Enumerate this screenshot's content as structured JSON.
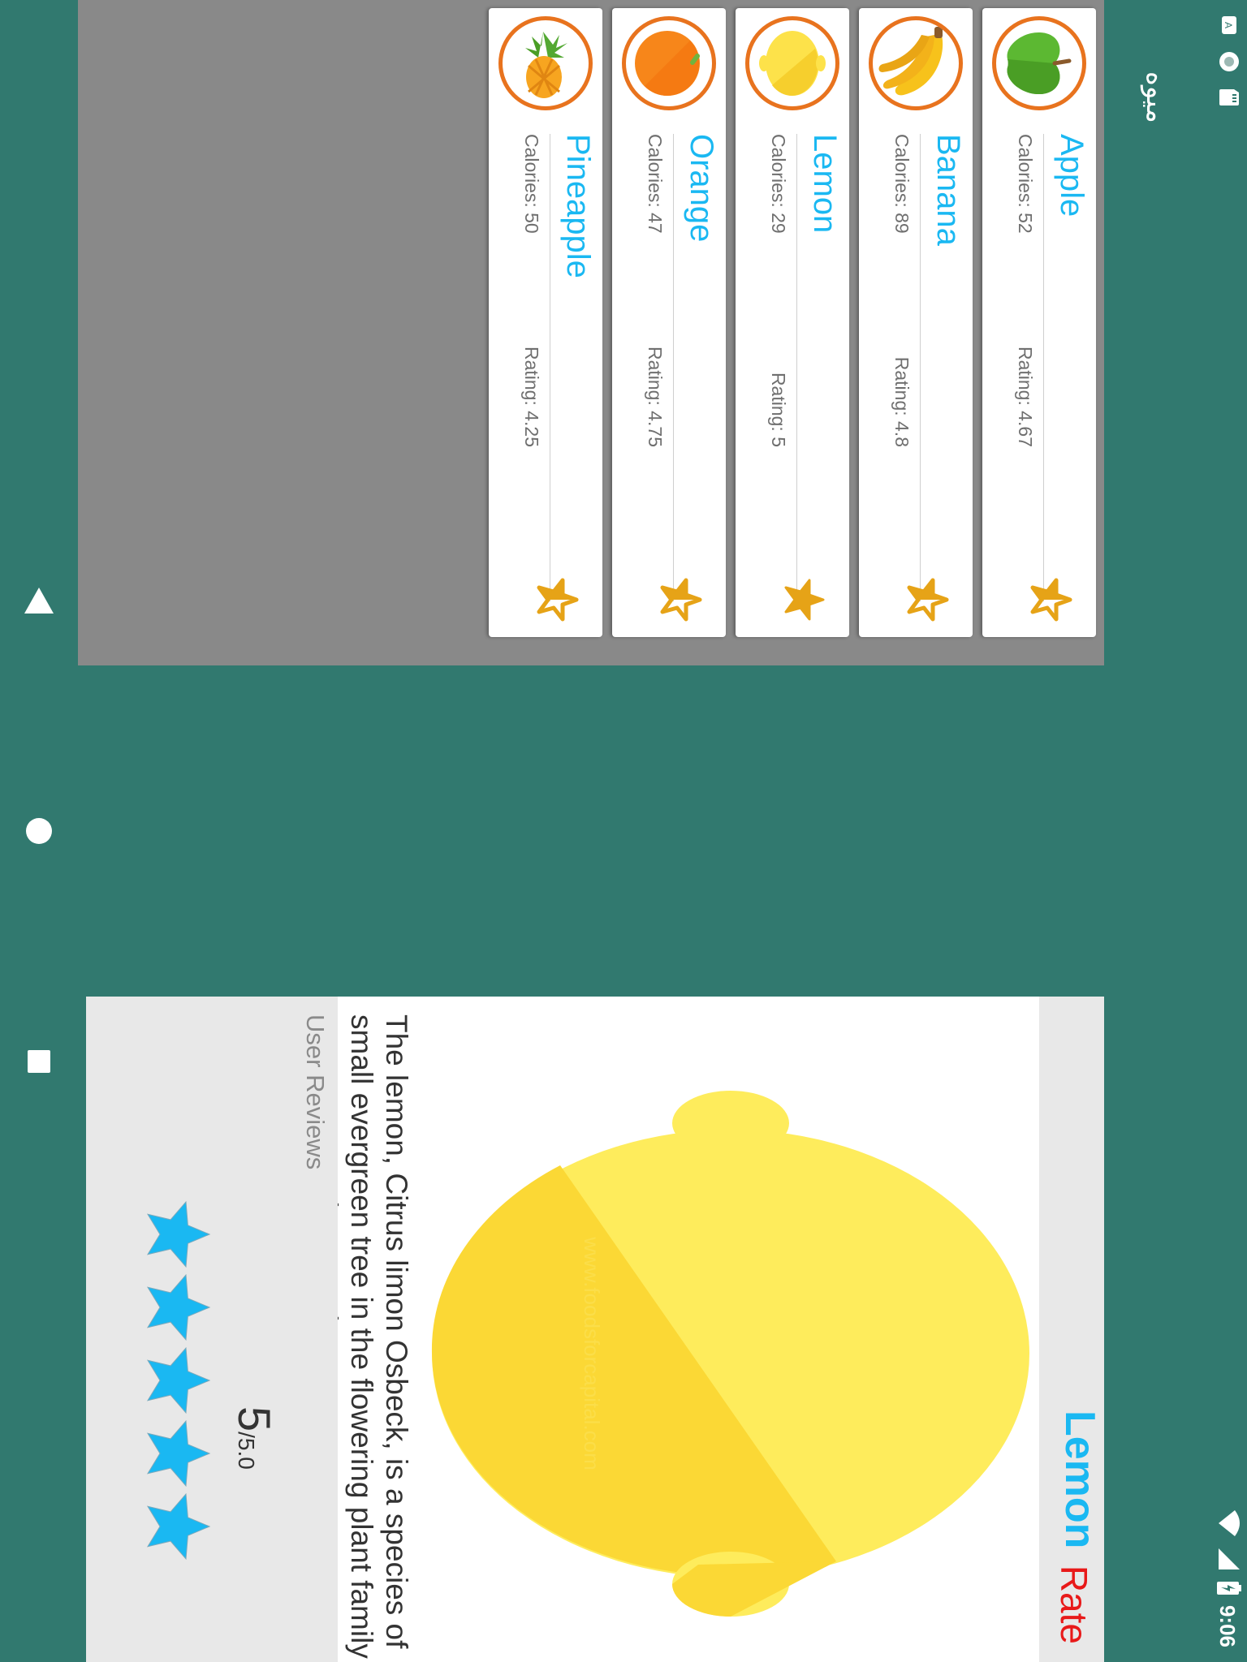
{
  "status_bar": {
    "time": "9:06",
    "icons": [
      "keyboard-icon",
      "sync-icon",
      "sd-card-icon",
      "wifi-icon",
      "signal-icon",
      "battery-charging-icon"
    ]
  },
  "app": {
    "title": "میوه"
  },
  "fruits": [
    {
      "name": "Apple",
      "calories": "Calories: 52",
      "rating": "Rating: 4.67",
      "rating_value": 4.67,
      "image": "apple-icon",
      "color": "#64b22e"
    },
    {
      "name": "Banana",
      "calories": "Calories: 89",
      "rating": "Rating: 4.8",
      "rating_value": 4.8,
      "image": "banana-icon",
      "color": "#f5c518"
    },
    {
      "name": "Lemon",
      "calories": "Calories: 29",
      "rating": "Rating: 5",
      "rating_value": 5,
      "image": "lemon-icon",
      "color": "#fde24a"
    },
    {
      "name": "Orange",
      "calories": "Calories: 47",
      "rating": "Rating: 4.75",
      "rating_value": 4.75,
      "image": "orange-icon",
      "color": "#f7861a"
    },
    {
      "name": "Pineapple",
      "calories": "Calories: 50",
      "rating": "Rating: 4.25",
      "rating_value": 4.25,
      "image": "pineapple-icon",
      "color": "#f7a520"
    }
  ],
  "detail": {
    "title": "Lemon",
    "image": "lemon-icon",
    "watermark": "www.foodsforcapital.com",
    "description": "The lemon, Citrus limon Osbeck, is a species of small evergreen tree in the flowering plant family Rutaceae, native to Asia.",
    "reviews_label": "User Reviews",
    "score": "5",
    "score_max": "/5.0",
    "stars_filled": 5,
    "stars_total": 5,
    "rate_label": "Rate"
  },
  "navigation": {
    "buttons": [
      "back-icon",
      "home-icon",
      "recents-icon"
    ]
  },
  "colors": {
    "app_bar": "#31796f",
    "accent_blue": "#1ab8f2",
    "rate_red": "#e81919",
    "avatar_ring": "#e8731e",
    "list_star": "#e6a317",
    "list_background": "#898989"
  }
}
